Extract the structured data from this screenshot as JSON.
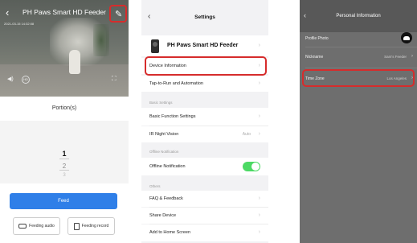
{
  "feeder_view": {
    "title": "PH Paws Smart HD Feeder",
    "back_glyph": "‹",
    "edit_glyph": "✎",
    "camera_timestamp": "2021-03-15 14:32:08",
    "portion_label": "Portion(s)",
    "picker_values": [
      "1",
      "2",
      "3"
    ],
    "feed_label": "Feed",
    "feeding_audio_label": "Feeding audio",
    "feeding_record_label": "Feeding record"
  },
  "settings": {
    "title": "Settings",
    "device_name": "PH Paws Smart HD Feeder",
    "items_top": [
      "Device Information",
      "Tap-to-Run and Automation"
    ],
    "basic_section": "Basic Settings",
    "basic_items": [
      "Basic Function Settings",
      "IR Night Vision"
    ],
    "ir_value": "Auto",
    "offline_section": "Offline Notification",
    "offline_item": "Offline Notification",
    "offline_toggle_on": true,
    "others_section": "Others",
    "others_items": [
      "FAQ & Feedback",
      "Share Device",
      "Add to Home Screen"
    ]
  },
  "personal_info": {
    "title": "Personal Information",
    "profile_photo_label": "Profile Photo",
    "nickname_label": "Nickname",
    "nickname_value": "Sam's Feeder",
    "timezone_label": "Time Zone",
    "timezone_value": "Los Angeles"
  },
  "colors": {
    "accent_blue": "#2f7fe8",
    "highlight_red": "#d62c2c",
    "toggle_green": "#4cd964"
  }
}
